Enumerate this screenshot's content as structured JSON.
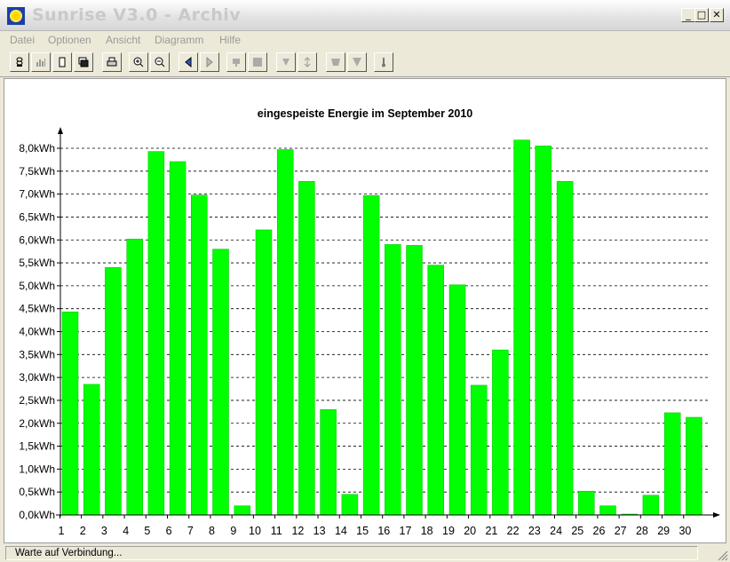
{
  "window": {
    "title": "Sunrise V3.0 - Archiv",
    "app_icon": "sun-icon"
  },
  "window_controls": {
    "minimize": "_",
    "maximize": "□",
    "close": "✕"
  },
  "menu": {
    "items": [
      "Datei",
      "Optionen",
      "Ansicht",
      "Diagramm",
      "Hilfe"
    ]
  },
  "toolbar": {
    "buttons": [
      "stack-icon",
      "bar-chart-icon",
      "document-icon",
      "windows-icon",
      "printer-icon",
      "zoom-in-icon",
      "zoom-out-icon",
      "previous-icon",
      "next-icon",
      "flag-icon",
      "square-icon",
      "pin-down-icon",
      "pin-up-icon",
      "fold-icon",
      "fold-down-icon",
      "thermometer-icon"
    ]
  },
  "status": {
    "text": "Warte auf Verbindung..."
  },
  "colors": {
    "bar": "#00ff00",
    "bar_border": "#00c000",
    "grid": "#000000",
    "chrome": "#ece9d8"
  },
  "chart_data": {
    "type": "bar",
    "title": "eingespeiste Energie im September 2010",
    "xlabel": "",
    "ylabel": "",
    "categories": [
      "1",
      "2",
      "3",
      "4",
      "5",
      "6",
      "7",
      "8",
      "9",
      "10",
      "11",
      "12",
      "13",
      "14",
      "15",
      "16",
      "17",
      "18",
      "19",
      "20",
      "21",
      "22",
      "23",
      "24",
      "25",
      "26",
      "27",
      "28",
      "29",
      "30"
    ],
    "values": [
      4.43,
      2.85,
      5.4,
      6.02,
      7.93,
      7.71,
      6.98,
      5.8,
      0.2,
      6.22,
      7.97,
      7.28,
      2.3,
      0.45,
      6.97,
      5.9,
      5.88,
      5.45,
      5.02,
      2.83,
      3.6,
      8.18,
      8.05,
      7.28,
      0.52,
      0.2,
      0.02,
      0.43,
      2.23,
      2.13
    ],
    "unit": "kWh",
    "ylim": [
      0,
      8
    ],
    "yticks": [
      "0,0kWh",
      "0,5kWh",
      "1,0kWh",
      "1,5kWh",
      "2,0kWh",
      "2,5kWh",
      "3,0kWh",
      "3,5kWh",
      "4,0kWh",
      "4,5kWh",
      "5,0kWh",
      "5,5kWh",
      "6,0kWh",
      "6,5kWh",
      "7,0kWh",
      "7,5kWh",
      "8,0kWh"
    ],
    "grid": "horizontal dashed",
    "legend": "none"
  }
}
